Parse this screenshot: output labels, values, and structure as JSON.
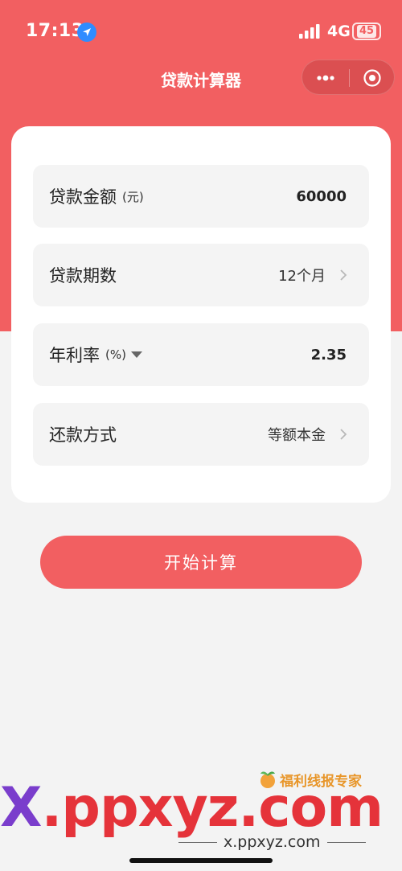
{
  "status": {
    "time": "17:13",
    "network": "4G",
    "battery": "45"
  },
  "nav": {
    "title": "贷款计算器"
  },
  "form": {
    "amount": {
      "label": "贷款金额",
      "unit": "(元)",
      "value": "60000"
    },
    "term": {
      "label": "贷款期数",
      "value": "12个月"
    },
    "rate": {
      "label": "年利率",
      "unit": "(%)",
      "value": "2.35"
    },
    "method": {
      "label": "还款方式",
      "value": "等额本金"
    }
  },
  "actions": {
    "start_label": "开始计算"
  },
  "watermark": {
    "brand": "福利线报专家",
    "big_prefix": "X",
    "big_rest": ".ppxyz.com",
    "small": "x.ppxyz.com"
  },
  "colors": {
    "accent": "#f25f61",
    "background": "#f3f3f3",
    "card": "#ffffff",
    "field": "#f4f4f4"
  }
}
